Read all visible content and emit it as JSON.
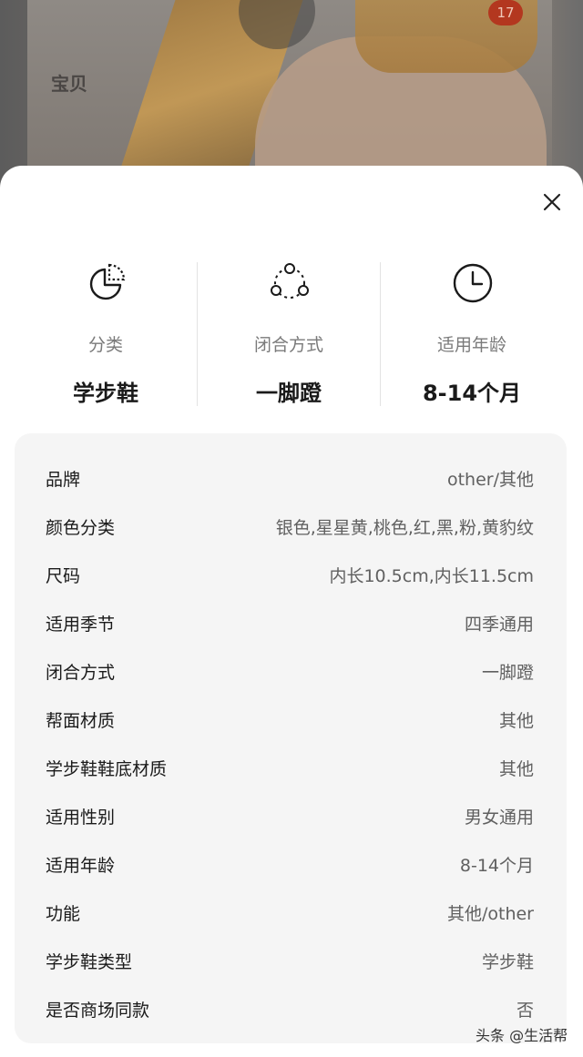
{
  "background": {
    "tab_label": "宝贝",
    "count_badge": "17"
  },
  "sheet": {
    "close_icon": "close-icon",
    "summary": [
      {
        "icon": "pie-chart-icon",
        "label": "分类",
        "value": "学步鞋"
      },
      {
        "icon": "three-dots-cycle-icon",
        "label": "闭合方式",
        "value": "一脚蹬"
      },
      {
        "icon": "clock-icon",
        "label": "适用年龄",
        "value": "8-14个月"
      }
    ],
    "specs": [
      {
        "key": "品牌",
        "value": "other/其他"
      },
      {
        "key": "颜色分类",
        "value": "银色,星星黄,桃色,红,黑,粉,黄豹纹"
      },
      {
        "key": "尺码",
        "value": "内长10.5cm,内长11.5cm"
      },
      {
        "key": "适用季节",
        "value": "四季通用"
      },
      {
        "key": "闭合方式",
        "value": "一脚蹬"
      },
      {
        "key": "帮面材质",
        "value": "其他"
      },
      {
        "key": "学步鞋鞋底材质",
        "value": "其他"
      },
      {
        "key": "适用性别",
        "value": "男女通用"
      },
      {
        "key": "适用年龄",
        "value": "8-14个月"
      },
      {
        "key": "功能",
        "value": "其他/other"
      },
      {
        "key": "学步鞋类型",
        "value": "学步鞋"
      },
      {
        "key": "是否商场同款",
        "value": "否"
      }
    ]
  },
  "watermark": "头条 @生活帮",
  "colors": {
    "sheet_bg": "#ffffff",
    "panel_bg": "#f5f5f5",
    "primary_text": "#1a1a1a",
    "secondary_text": "#606060",
    "badge": "#b3371f"
  }
}
